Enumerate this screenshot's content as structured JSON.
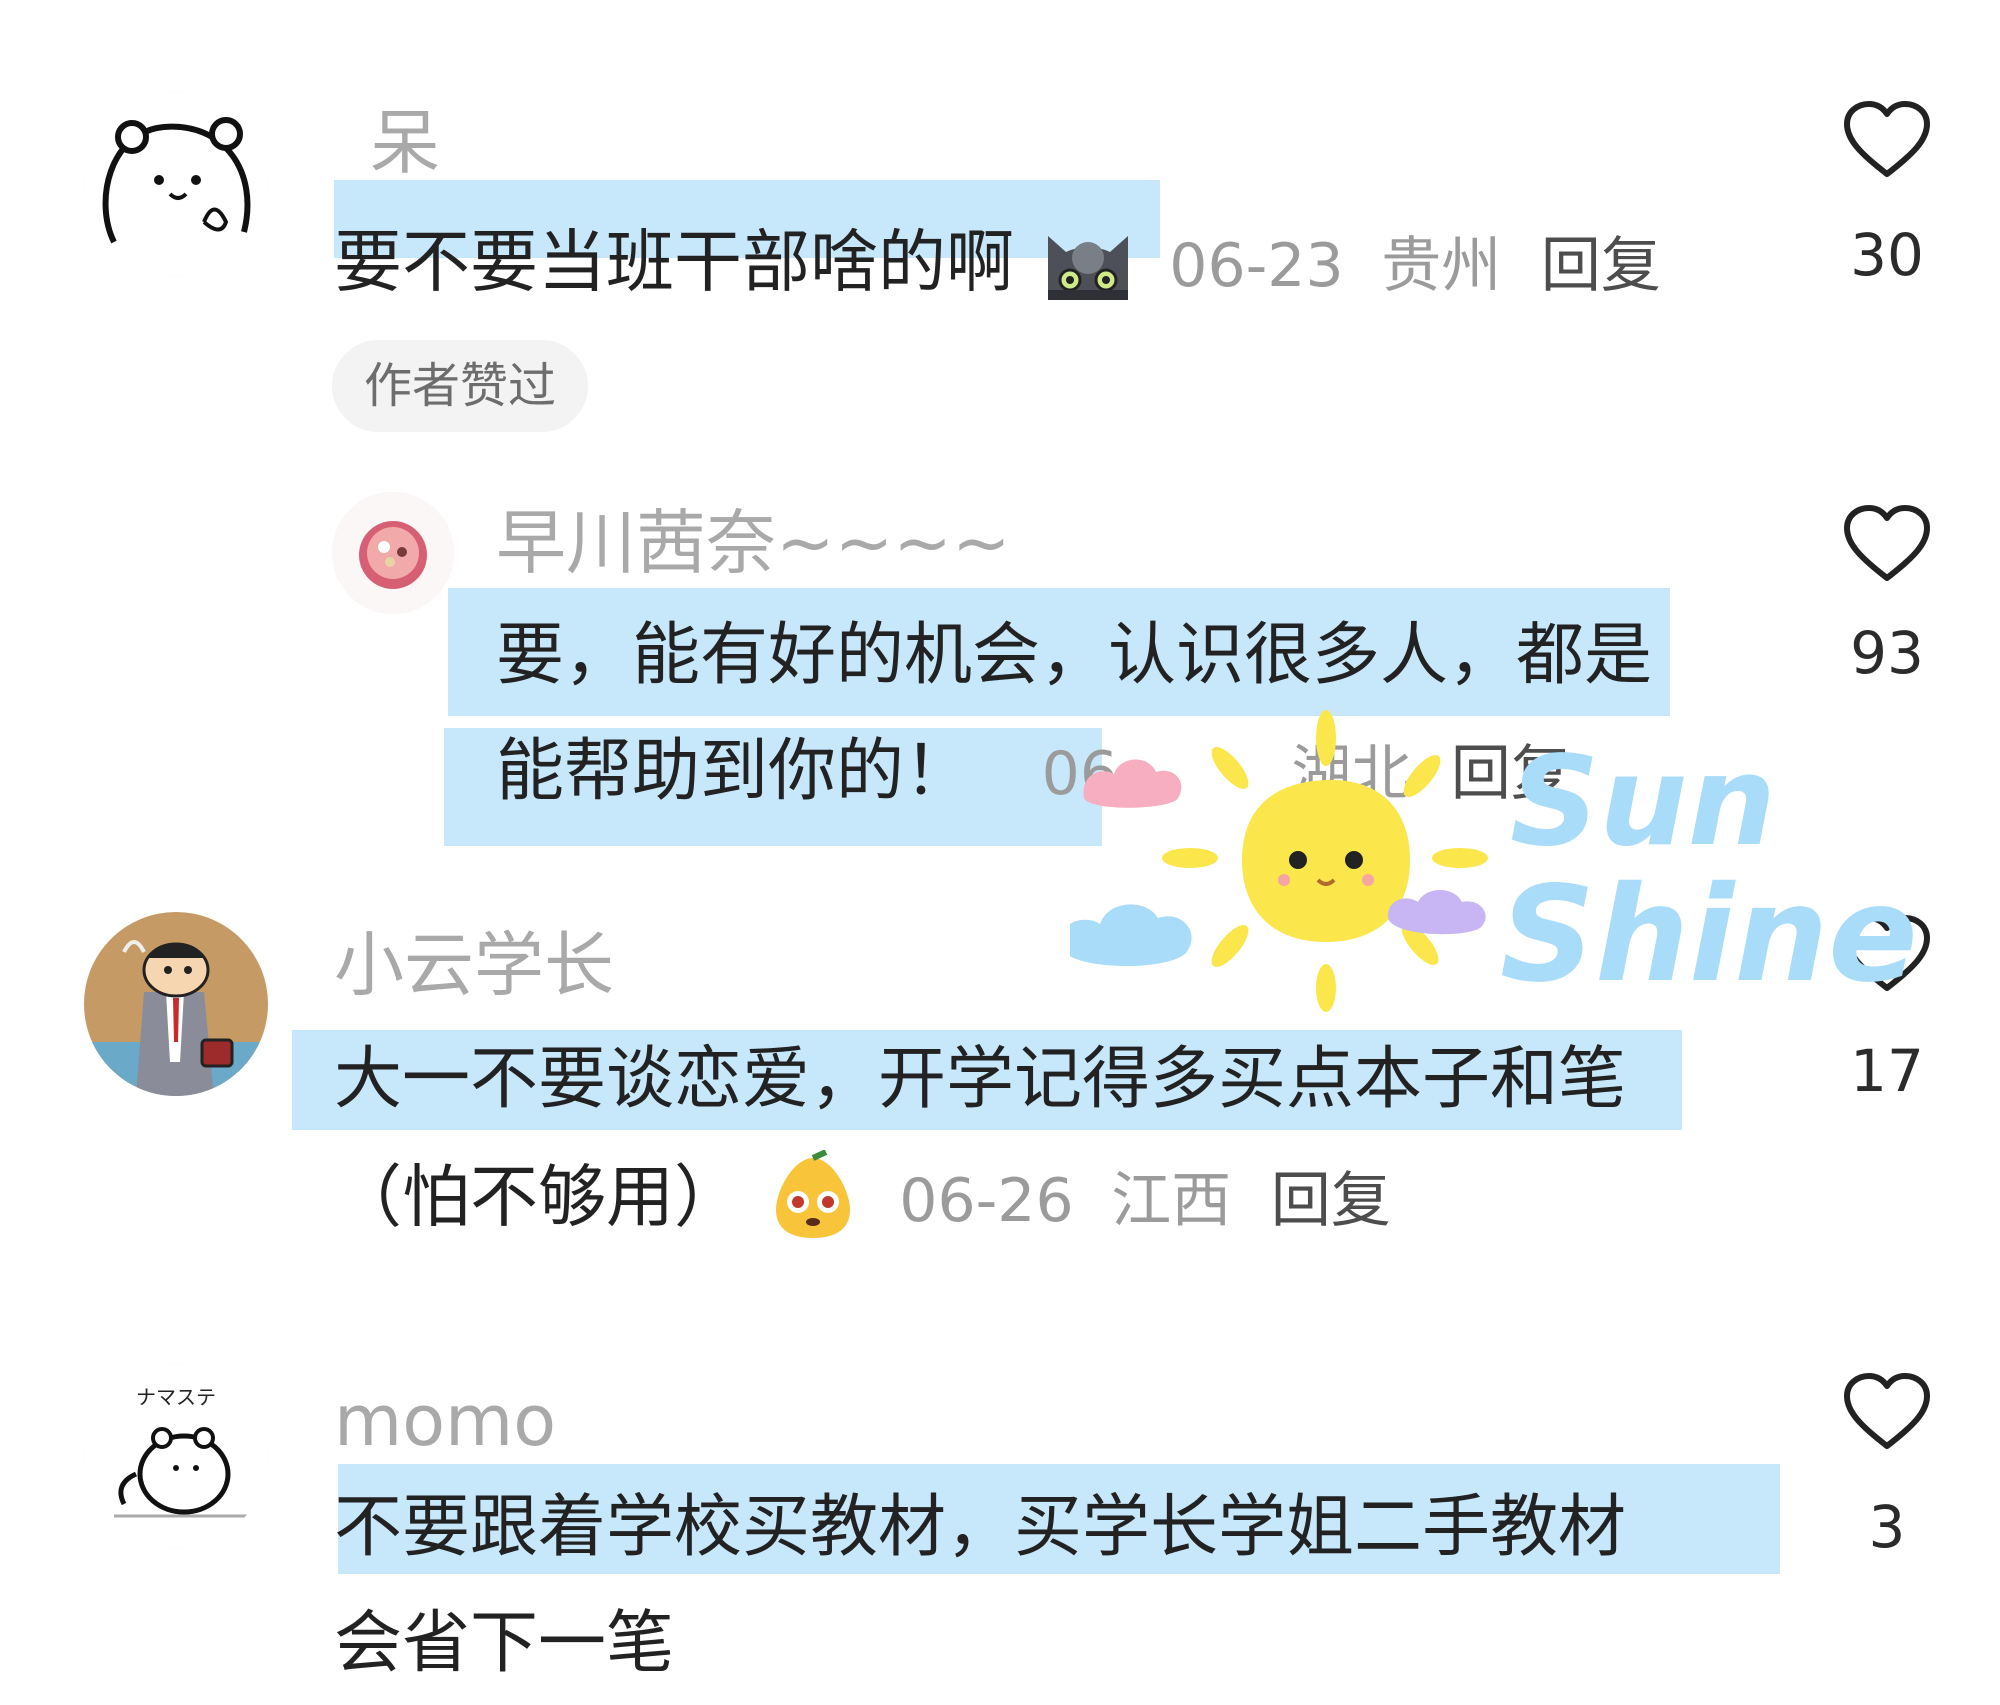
{
  "comments": [
    {
      "username": "呆",
      "text": "要不要当班干部啥的啊",
      "date": "06-23",
      "location": "贵州",
      "reply": "回复",
      "badge": "作者赞过",
      "likes": "30",
      "avatar_icon": "bear-avatar-icon",
      "emoji_icon": "cat-emoji-icon"
    },
    {
      "username": "早川茜奈~~~~",
      "text_line1": "要，能有好的机会，认识很多人，都是",
      "text_line2": "能帮助到你的！",
      "date": "06-",
      "location_partial": "湖北",
      "reply": "回复",
      "likes": "93",
      "avatar_icon": "dessert-avatar-icon",
      "is_reply": true
    },
    {
      "username": "小云学长",
      "text_line1": "大一不要谈恋爱，开学记得多买点本子和笔",
      "text_line2": "（怕不够用）",
      "date": "06-26",
      "location": "江西",
      "reply": "回复",
      "likes": "17",
      "avatar_icon": "cartoon-boy-avatar-icon",
      "emoji_icon": "pear-face-emoji-icon"
    },
    {
      "username": "momo",
      "text_line1": "不要跟着学校买教材，买学长学姐二手教材",
      "text_line2": "会省下一笔",
      "likes": "3",
      "avatar_icon": "bear-avatar-icon"
    }
  ],
  "sticker": {
    "line1": "Sun",
    "line2": "Shine",
    "icon": "sun-sticker-icon"
  },
  "colors": {
    "highlight": "#c7e7fb",
    "username": "#a9a9a9",
    "meta": "#9b9b9b",
    "sticker_text": "#a9dcf8",
    "sun": "#fbe64c"
  }
}
